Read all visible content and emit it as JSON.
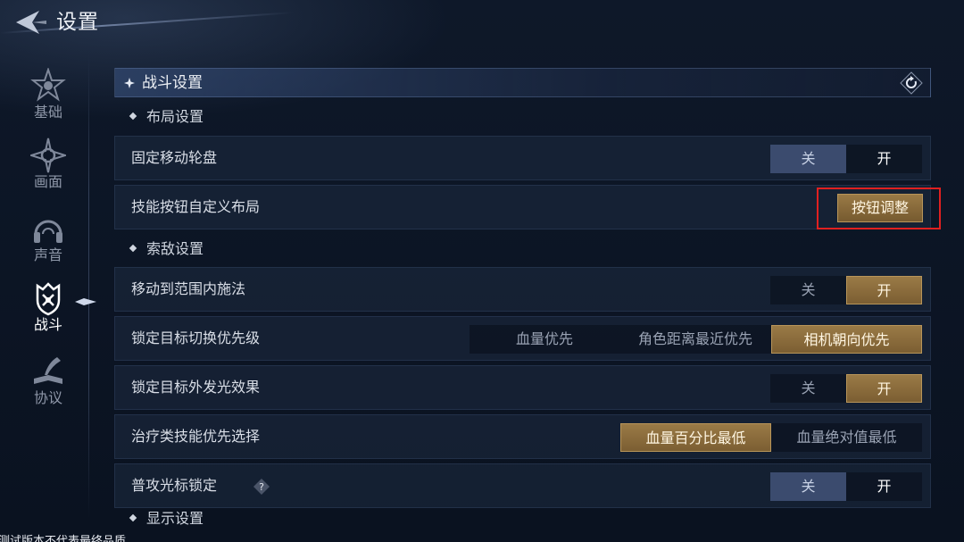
{
  "header": {
    "title": "设置"
  },
  "sidebar": {
    "items": [
      {
        "label": "基础",
        "icon": "compass-star-icon"
      },
      {
        "label": "画面",
        "icon": "gear-star-icon"
      },
      {
        "label": "声音",
        "icon": "headphones-icon"
      },
      {
        "label": "战斗",
        "icon": "shield-crest-icon",
        "active": true
      },
      {
        "label": "协议",
        "icon": "quill-book-icon"
      }
    ]
  },
  "section": {
    "title": "战斗设置",
    "reset_icon": "reset-icon"
  },
  "groups": {
    "layout": "布局设置",
    "targeting": "索敌设置",
    "display": "显示设置"
  },
  "rows": {
    "fixed_joystick": {
      "label": "固定移动轮盘",
      "options": [
        "关",
        "开"
      ],
      "selected": "关"
    },
    "custom_layout": {
      "label": "技能按钮自定义布局",
      "button": "按钮调整"
    },
    "cast_in_range": {
      "label": "移动到范围内施法",
      "options": [
        "关",
        "开"
      ],
      "selected": "开"
    },
    "target_priority": {
      "label": "锁定目标切换优先级",
      "options": [
        "血量优先",
        "角色距离最近优先",
        "相机朝向优先"
      ],
      "selected": "相机朝向优先"
    },
    "target_glow": {
      "label": "锁定目标外发光效果",
      "options": [
        "关",
        "开"
      ],
      "selected": "开"
    },
    "heal_priority": {
      "label": "治疗类技能优先选择",
      "options": [
        "血量百分比最低",
        "血量绝对值最低"
      ],
      "selected": "血量百分比最低"
    },
    "cursor_lock": {
      "label": "普攻光标锁定",
      "help": "?",
      "options": [
        "关",
        "开"
      ],
      "selected": "关"
    }
  },
  "watermark": "测试版本不代表最终品质",
  "colors": {
    "accent_gold": "#9a7a46",
    "off_selected": "#3b4b6e",
    "highlight_red": "#e02020"
  }
}
